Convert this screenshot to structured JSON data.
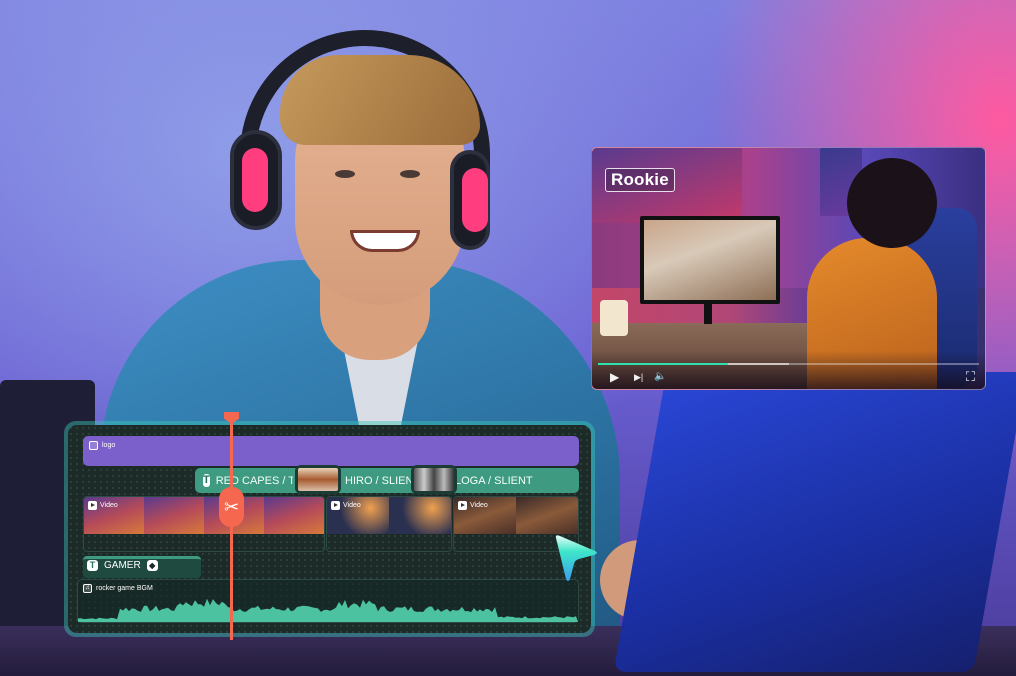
{
  "player": {
    "overlay_title": "Rookie",
    "progress_played": 0.34,
    "progress_buffered": 0.5,
    "controls": {
      "play_icon": "play-icon",
      "next_icon": "skip-next-icon",
      "volume_icon": "volume-icon",
      "fullscreen_icon": "fullscreen-icon"
    },
    "glyphs": {
      "play": "▶",
      "next": "▶|",
      "volume": "🔈",
      "fullscreen": "⛶"
    }
  },
  "timeline": {
    "colors": {
      "accent": "#3e9a80",
      "logo_track": "#7b5fcb",
      "playhead": "#f5684f",
      "waveform": "#4cc2a0"
    },
    "tracks": {
      "logo": {
        "label": "logo",
        "icon": "image-icon"
      },
      "titles": [
        {
          "label": "RED CAPES / TOUCH",
          "icon": "text-icon"
        },
        {
          "label": "HIRO / SLIENT",
          "icon": "text-icon"
        },
        {
          "label": "LOGA / SLIENT",
          "icon": "text-icon"
        }
      ],
      "videos": [
        {
          "label": "Video",
          "icon": "video-icon"
        },
        {
          "label": "Video",
          "icon": "video-icon"
        },
        {
          "label": "Video",
          "icon": "video-icon"
        }
      ],
      "text_clip": {
        "label": "GAMER",
        "icon": "text-icon",
        "t_glyph": "T"
      },
      "audio": {
        "label": "rocker game BGM",
        "icon": "music-icon"
      }
    },
    "scissors_glyph": "✂",
    "t_glyph": "T"
  }
}
